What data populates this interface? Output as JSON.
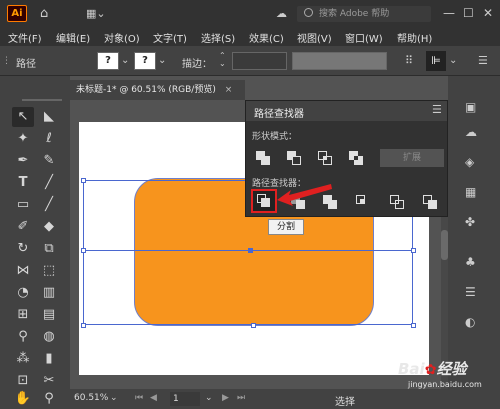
{
  "titlebar": {
    "logo": "Ai",
    "search_placeholder": "搜索 Adobe 帮助",
    "icons": [
      "home-icon",
      "workspace-icon",
      "cloud-icon",
      "search-icon"
    ]
  },
  "menu": [
    "文件(F)",
    "编辑(E)",
    "对象(O)",
    "文字(T)",
    "选择(S)",
    "效果(C)",
    "视图(V)",
    "窗口(W)",
    "帮助(H)"
  ],
  "controlbar": {
    "object_label": "路径",
    "q1": "?",
    "q2": "?",
    "stroke_label": "描边：",
    "stroke_arrows": "⌃⌄"
  },
  "document": {
    "tab_title": "未标题-1* @ 60.51% (RGB/预览)",
    "tab_close": "×"
  },
  "pathfinder": {
    "title": "路径查找器",
    "section_shape": "形状模式：",
    "expand_button": "扩展",
    "section_pathfinders": "路径查找器：",
    "tooltip": "分割"
  },
  "status": {
    "zoom": "60.51%",
    "page": "1",
    "select_label": "选择"
  },
  "watermark": {
    "line1": "Bai",
    "line2": "经验",
    "line3": "jingyan.baidu.com"
  },
  "colors": {
    "orange_fill": "#f7941d",
    "selection": "#4a67cf",
    "highlight_box": "#e02020"
  }
}
